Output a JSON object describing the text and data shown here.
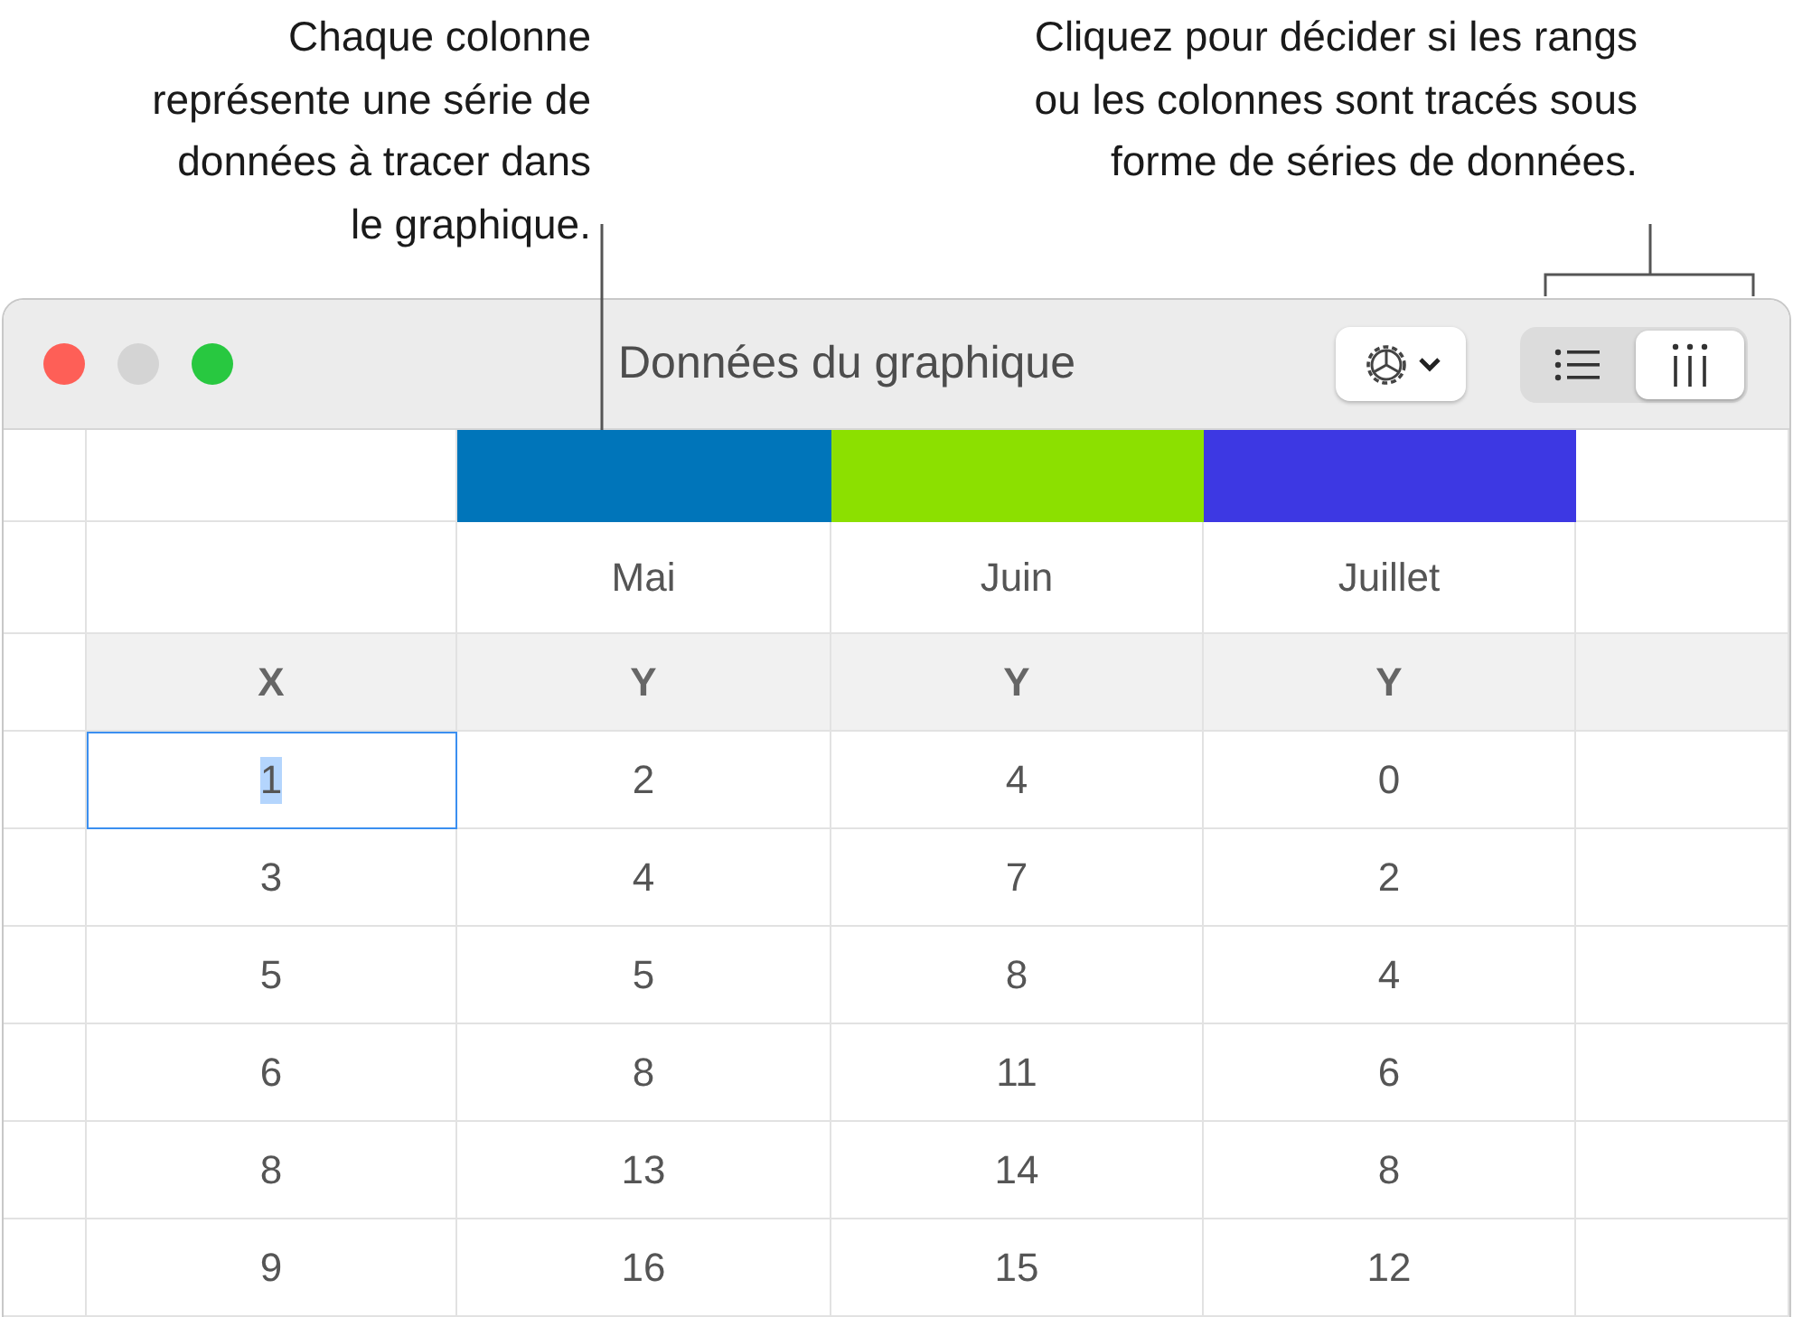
{
  "callouts": [
    {
      "text": "Chaque colonne représente une série de données à tracer dans le graphique."
    },
    {
      "text": "Cliquez pour décider si les rangs ou les colonnes sont tracés sous forme de séries de données."
    }
  ],
  "window": {
    "title": "Données du graphique"
  },
  "view_toggle": [
    {
      "kind": "rows",
      "selected": false
    },
    {
      "kind": "columns",
      "selected": true
    }
  ],
  "series": [
    {
      "name": "Mai",
      "color": "#0075ba"
    },
    {
      "name": "Juin",
      "color": "#8ce000"
    },
    {
      "name": "Juillet",
      "color": "#3d38e3"
    }
  ],
  "column_headers": [
    "X",
    "Y",
    "Y",
    "Y"
  ],
  "rows": [
    [
      {
        "value": "1",
        "selected": true
      },
      {
        "value": "2",
        "selected": false
      },
      {
        "value": "4",
        "selected": false
      },
      {
        "value": "0",
        "selected": false
      }
    ],
    [
      {
        "value": "3",
        "selected": false
      },
      {
        "value": "4",
        "selected": false
      },
      {
        "value": "7",
        "selected": false
      },
      {
        "value": "2",
        "selected": false
      }
    ],
    [
      {
        "value": "5",
        "selected": false
      },
      {
        "value": "5",
        "selected": false
      },
      {
        "value": "8",
        "selected": false
      },
      {
        "value": "4",
        "selected": false
      }
    ],
    [
      {
        "value": "6",
        "selected": false
      },
      {
        "value": "8",
        "selected": false
      },
      {
        "value": "11",
        "selected": false
      },
      {
        "value": "6",
        "selected": false
      }
    ],
    [
      {
        "value": "8",
        "selected": false
      },
      {
        "value": "13",
        "selected": false
      },
      {
        "value": "14",
        "selected": false
      },
      {
        "value": "8",
        "selected": false
      }
    ],
    [
      {
        "value": "9",
        "selected": false
      },
      {
        "value": "16",
        "selected": false
      },
      {
        "value": "15",
        "selected": false
      },
      {
        "value": "12",
        "selected": false
      }
    ]
  ]
}
